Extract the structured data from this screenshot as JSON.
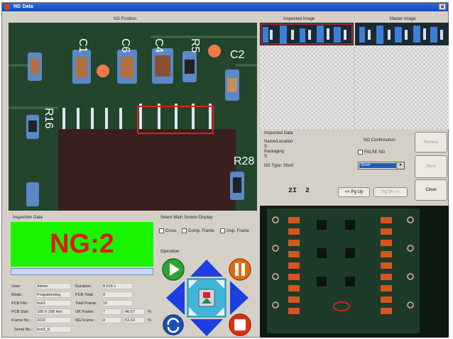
{
  "window": {
    "title": "NG Data"
  },
  "ng_position": {
    "label": "NG Position"
  },
  "inspected_image": {
    "label": "Inspected Image"
  },
  "master_image": {
    "label": "Master Image"
  },
  "inspected_data": {
    "title": "Inspected Data",
    "name_location_label": "Name/Location",
    "name_location_value": "S",
    "packaging_label": "Packaging",
    "packaging_value": "S",
    "ng_type_label": "NG Type",
    "ng_type_value": "Short"
  },
  "ng_confirmation": {
    "title": "NG Confirmation",
    "false_ng_label": "FALSE NG",
    "selected_type": "Short"
  },
  "side_buttons": {
    "top": "Review",
    "mid": "Next"
  },
  "counter": {
    "current": "2",
    "total": "2",
    "sep": "I"
  },
  "pager": {
    "pg_up": "<< Pg Up",
    "pg_down": "Pg Dn >>",
    "close": "Close"
  },
  "inspection": {
    "title": "Inspection Data",
    "ng_text": "NG:2",
    "progress": 1.0,
    "user_label": "User:",
    "user_value": "Admin",
    "mode_label": "Mode:",
    "mode_value": "Programming",
    "pcb_file_label": "PCB File:",
    "pcb_file_value": "test1",
    "pcb_size_label": "PCB Size:",
    "pcb_size_value": "185 X 158 mm",
    "frame_no_label": "Frame No.:",
    "frame_no_value": "2/2/2",
    "serial_label": "Serial No.:",
    "serial_value": "test1_6",
    "duration_label": "Duration:",
    "duration_value": "8.516 s",
    "pcb_total_label": "PCB Total:",
    "pcb_total_value": "8",
    "total_frame_label": "Total Frame:",
    "total_frame_value": "15",
    "ok_frame_label": "OK Frame:",
    "ok_frame_value": "7",
    "ok_pct": "46.67",
    "pct_sign": "%",
    "ng_frame_label": "NG Frame:",
    "ng_frame_value": "8",
    "ng_pct": "53.33"
  },
  "display": {
    "title": "Select Main Screen Display",
    "cross": "Cross",
    "comp_frame": "Comp. Frame",
    "insp_frame": "Insp. Frame",
    "operation": "Operation"
  },
  "board_labels": {
    "c1": "C1",
    "c6": "C6",
    "c4": "C4",
    "r5": "R5",
    "c2": "C2",
    "r16": "R16",
    "r28": "R28",
    "num3": "3"
  },
  "colors": {
    "ng_bg": "#19f500",
    "ng_text": "#e1161a",
    "arrow": "#1d3ee0",
    "play": "#2aa333",
    "pause": "#e06a10",
    "stop": "#e03010",
    "refresh": "#1e4fb8"
  }
}
